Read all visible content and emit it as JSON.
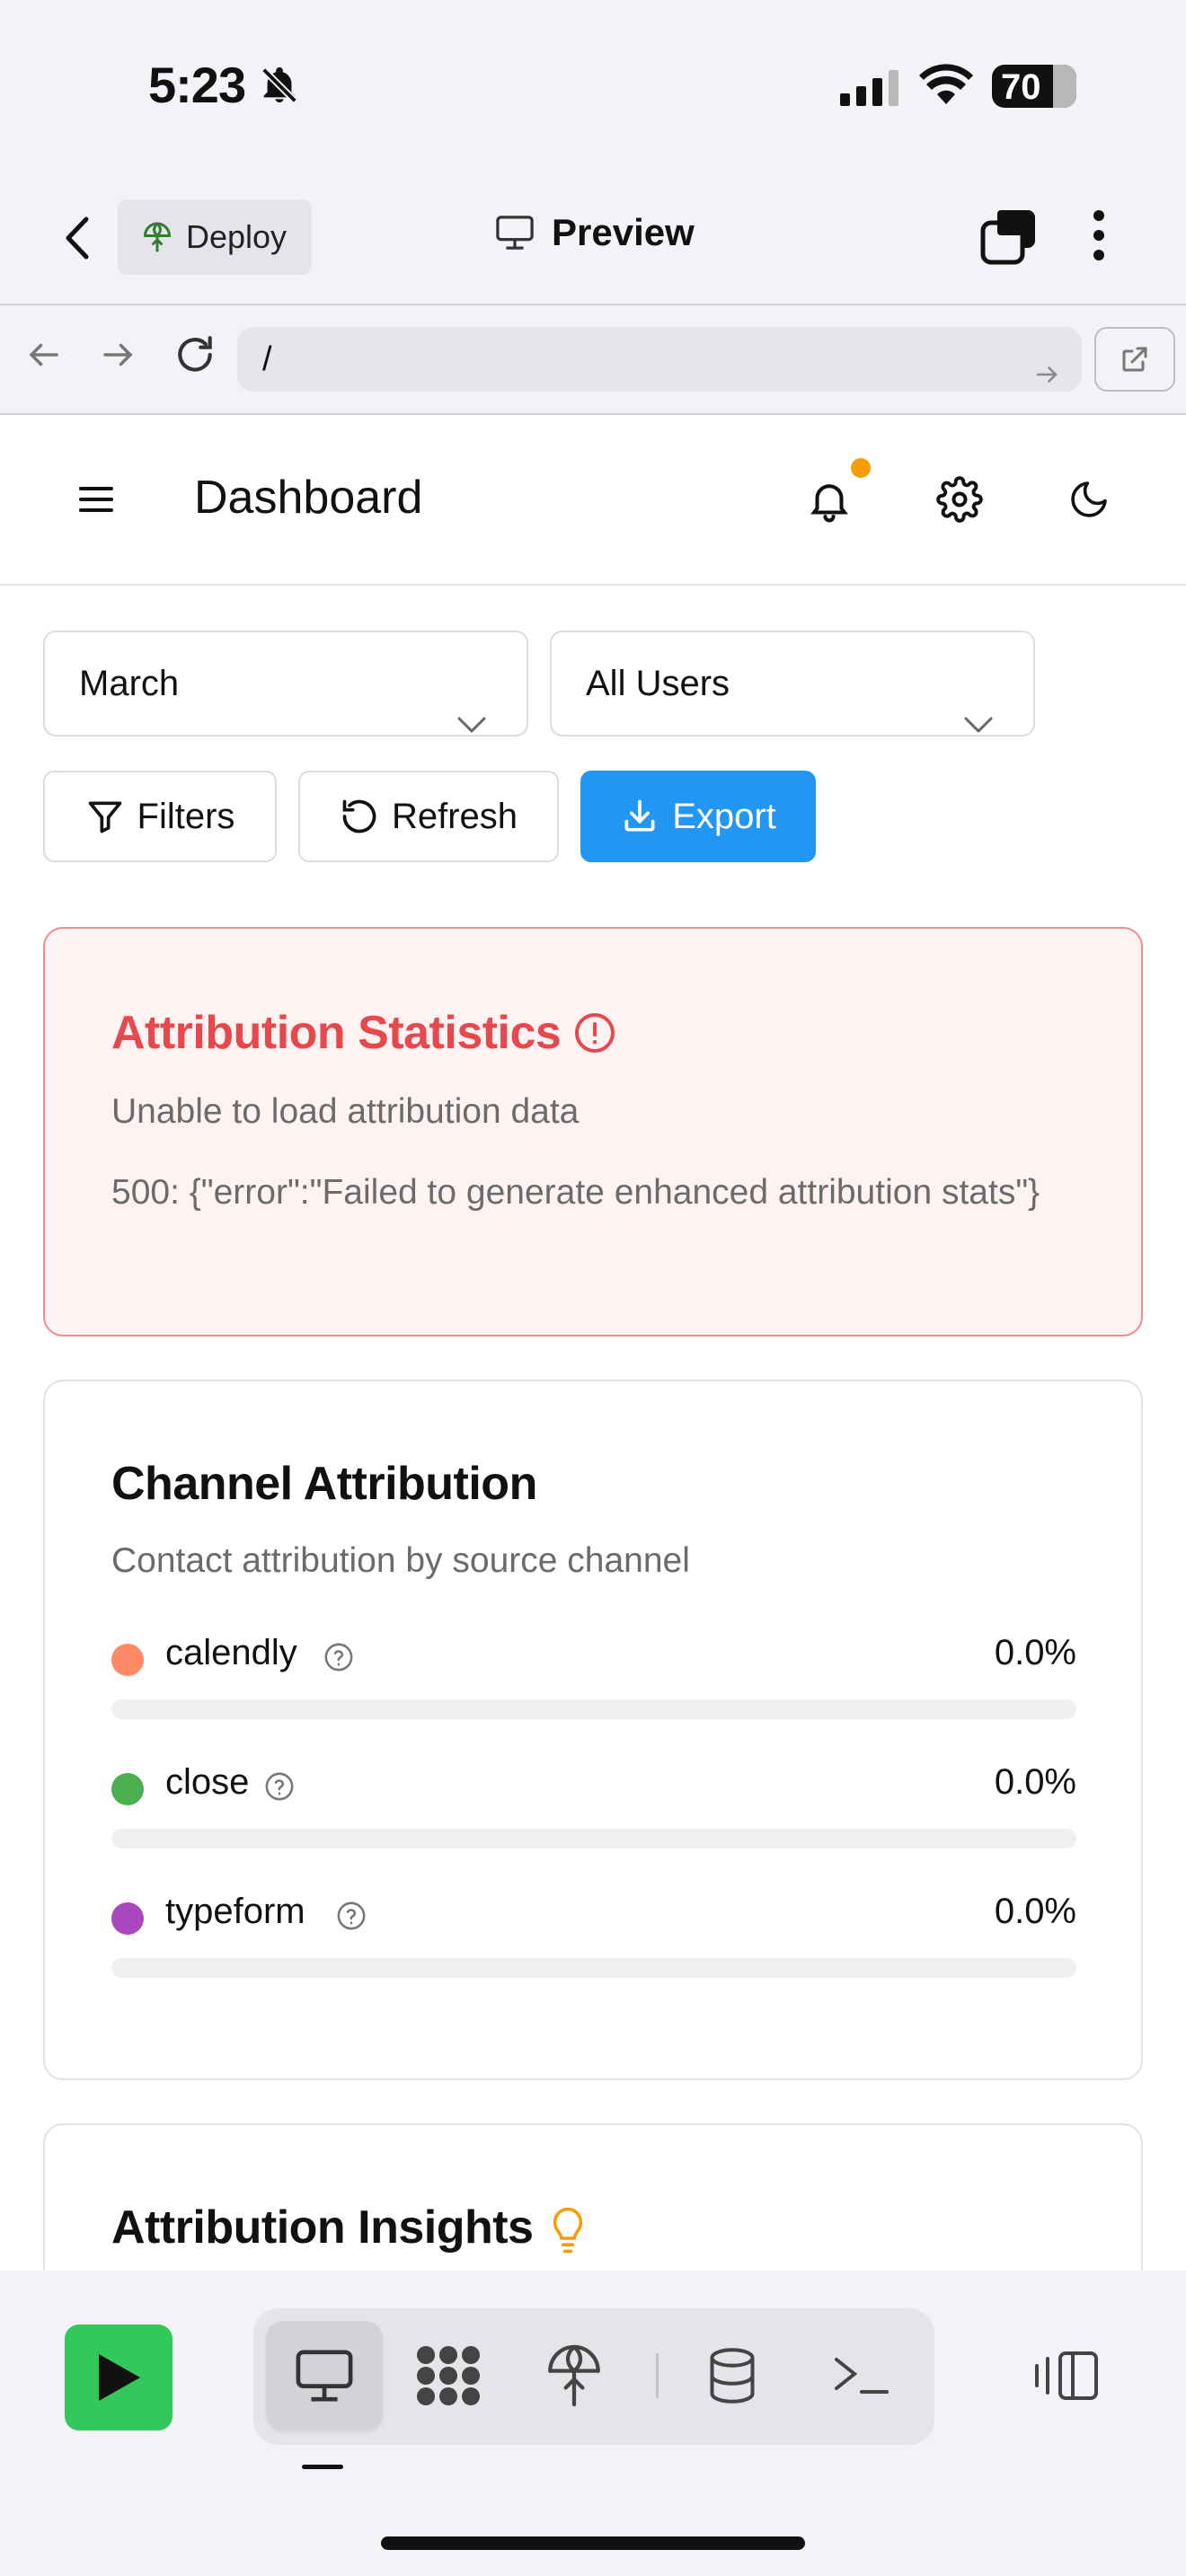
{
  "status_bar": {
    "time": "5:23",
    "battery": "70"
  },
  "app_bar": {
    "deploy_label": "Deploy",
    "preview_label": "Preview"
  },
  "url_bar": {
    "url": "/"
  },
  "dashboard": {
    "title": "Dashboard",
    "filters": {
      "month": "March",
      "users": "All Users"
    },
    "buttons": {
      "filters": "Filters",
      "refresh": "Refresh",
      "export": "Export"
    },
    "colors": {
      "accent": "#2196f3",
      "error": "#e5484d",
      "notification_dot": "#f59e0b"
    }
  },
  "error_card": {
    "title": "Attribution Statistics",
    "message": "Unable to load attribution data",
    "detail": "500: {\"error\":\"Failed to generate enhanced attribution stats\"}"
  },
  "channel_card": {
    "title": "Channel Attribution",
    "subtitle": "Contact attribution by source channel",
    "channels": [
      {
        "name": "calendly",
        "percent": "0.0%",
        "value": 0.0,
        "color": "#ff8a65"
      },
      {
        "name": "close",
        "percent": "0.0%",
        "value": 0.0,
        "color": "#4caf50"
      },
      {
        "name": "typeform",
        "percent": "0.0%",
        "value": 0.0,
        "color": "#ab47bc"
      }
    ]
  },
  "insights_card": {
    "title": "Attribution Insights"
  },
  "toolbar": {
    "active_tab": "preview",
    "tabs": [
      "preview-icon",
      "grid-icon",
      "deploy-icon",
      "database-icon",
      "terminal-icon"
    ],
    "run_color": "#34c759"
  }
}
